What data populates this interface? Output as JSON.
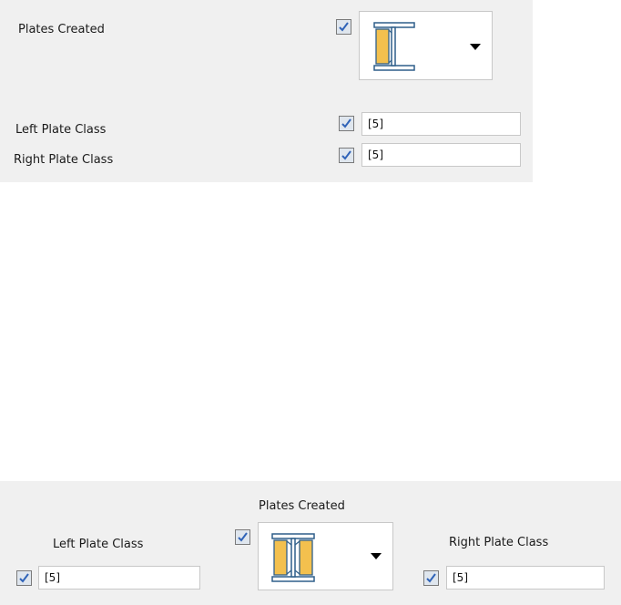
{
  "top_section": {
    "plates_created_label": "Plates Created",
    "left_plate_class_label": "Left Plate Class",
    "left_plate_class_value": "[5]",
    "right_plate_class_label": "Right Plate Class",
    "right_plate_class_value": "[5]"
  },
  "bottom_section": {
    "plates_created_label": "Plates Created",
    "left_plate_class_label": "Left Plate Class",
    "left_plate_class_value": "[5]",
    "right_plate_class_label": "Right Plate Class",
    "right_plate_class_value": "[5]"
  },
  "checkbox_states": {
    "checked": true
  },
  "icons": {
    "profile_top": "i-beam-left-plate-icon",
    "profile_bottom": "i-beam-both-plates-icon",
    "dropdown": "dropdown-arrow-icon"
  },
  "colors": {
    "panel_bg": "#f0f0f0",
    "plate_fill": "#f3c04e",
    "beam_stroke": "#2f5f8a",
    "checkbox_fill": "#dfe6ee",
    "check_mark": "#2f63b8"
  }
}
